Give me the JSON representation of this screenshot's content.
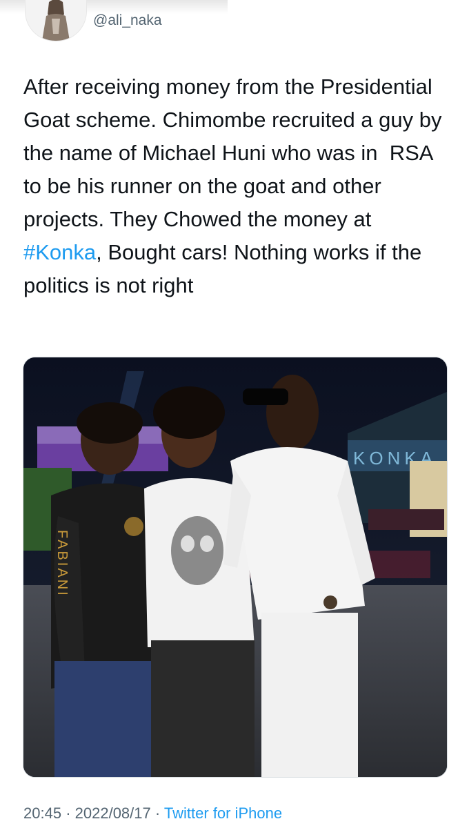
{
  "author": {
    "handle": "@ali_naka"
  },
  "tweet": {
    "text_before": "After receiving money from the Presidential Goat scheme. Chimombe recruited a guy by the name of Michael Huni who was in  RSA to be his runner on the goat and other projects. They Chowed the money at ",
    "hashtag": "#Konka",
    "text_after": ", Bought cars! Nothing works if the politics is not right"
  },
  "media": {
    "shirt_text": "FABIANI",
    "sign_text": "KONKA"
  },
  "meta": {
    "time": "20:45",
    "separator": "·",
    "date": "2022/08/17",
    "source": "Twitter for iPhone"
  },
  "colors": {
    "link": "#1d9bf0",
    "secondary_text": "#536471",
    "primary_text": "#0f1419"
  }
}
